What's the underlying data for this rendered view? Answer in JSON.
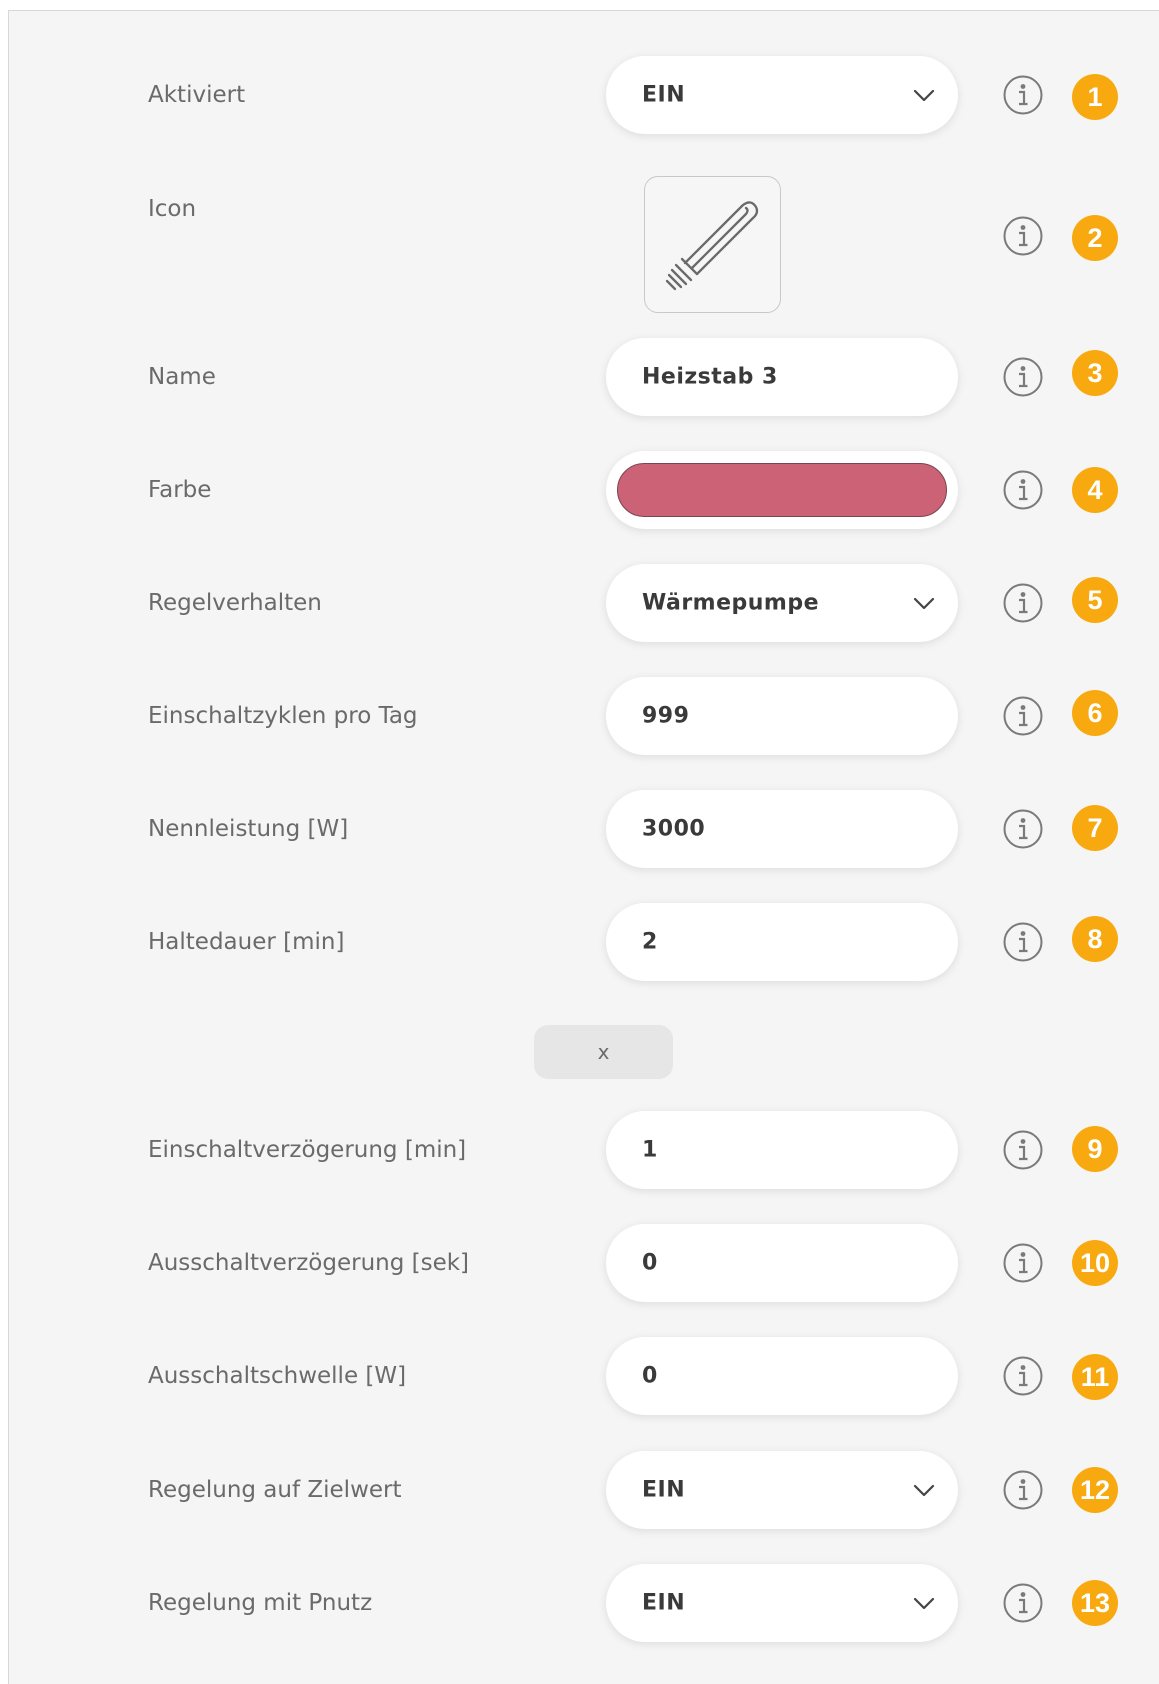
{
  "form": {
    "activated": {
      "label": "Aktiviert",
      "value": "EIN",
      "badge": "1"
    },
    "icon": {
      "label": "Icon",
      "icon_name": "heating-rod-icon",
      "badge": "2"
    },
    "name": {
      "label": "Name",
      "value": "Heizstab 3",
      "badge": "3"
    },
    "color": {
      "label": "Farbe",
      "value": "#cb6276",
      "badge": "4"
    },
    "control_behavior": {
      "label": "Regelverhalten",
      "value": "Wärmepumpe",
      "badge": "5"
    },
    "cycles_per_day": {
      "label": "Einschaltzyklen pro Tag",
      "value": "999",
      "badge": "6"
    },
    "rated_power": {
      "label": "Nennleistung [W]",
      "value": "3000",
      "badge": "7"
    },
    "hold_time": {
      "label": "Haltedauer [min]",
      "value": "2",
      "badge": "8"
    },
    "clear_button": {
      "label": "x"
    },
    "switch_on_delay": {
      "label": "Einschaltverzögerung [min]",
      "value": "1",
      "badge": "9"
    },
    "switch_off_delay": {
      "label": "Ausschaltverzögerung [sek]",
      "value": "0",
      "badge": "10"
    },
    "switch_off_threshold": {
      "label": "Ausschaltschwelle [W]",
      "value": "0",
      "badge": "11"
    },
    "target_control": {
      "label": "Regelung auf Zielwert",
      "value": "EIN",
      "badge": "12"
    },
    "pnutz_control": {
      "label": "Regelung mit Pnutz",
      "value": "EIN",
      "badge": "13"
    }
  },
  "colors": {
    "badge": "#f8a90f",
    "panel_background": "#f5f5f5",
    "label_text": "#6a6a6a",
    "value_text": "#3a3a3a"
  }
}
